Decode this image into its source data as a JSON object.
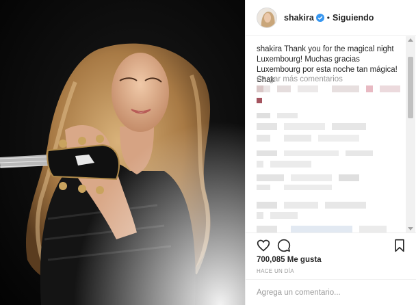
{
  "post": {
    "username": "shakira",
    "separator": "•",
    "follow_status": "Siguiendo",
    "caption_user": "shakira",
    "caption_text": "Thank you for the magical night Luxembourg! Muchas gracias Luxembourg por esta noche tan mágica! Shak",
    "load_more": "Cargar más comentarios",
    "likes": "700,085 Me gusta",
    "time_ago": "HACE UN DÍA",
    "comment_placeholder": "Agrega un comentario..."
  },
  "icons": {
    "like": "heart-icon",
    "comment": "comment-bubble-icon",
    "save": "bookmark-icon",
    "verified": "verified-badge-icon"
  },
  "colors": {
    "verified": "#3897f0",
    "muted": "#999999",
    "text": "#262626",
    "border": "#efefef"
  }
}
